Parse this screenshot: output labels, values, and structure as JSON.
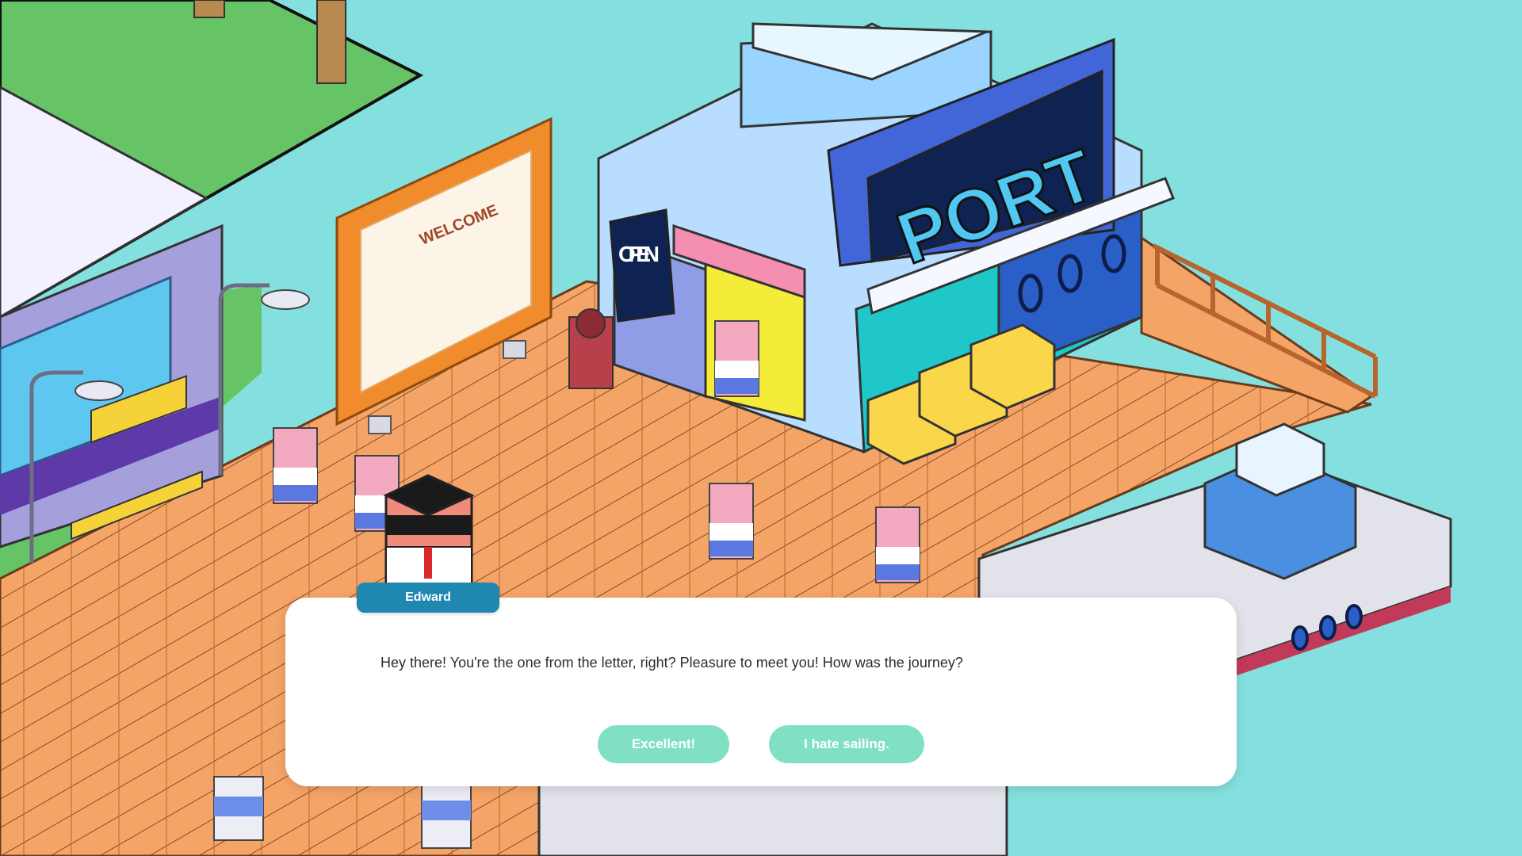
{
  "scene": {
    "welcome_sign": "WELCOME",
    "open_sign": "OPEN",
    "port_sign": "PORT"
  },
  "dialog": {
    "speaker": "Edward",
    "text": "Hey there! You're the one from the letter, right? Pleasure to meet you! How was the journey?",
    "choices": [
      {
        "label": "Excellent!"
      },
      {
        "label": "I hate sailing."
      }
    ]
  },
  "colors": {
    "water": "#84e0de",
    "deck": "#f4a467",
    "name_tag": "#1e88b0",
    "choice_button": "#7fe0c4",
    "dialog_bg": "#ffffff"
  }
}
